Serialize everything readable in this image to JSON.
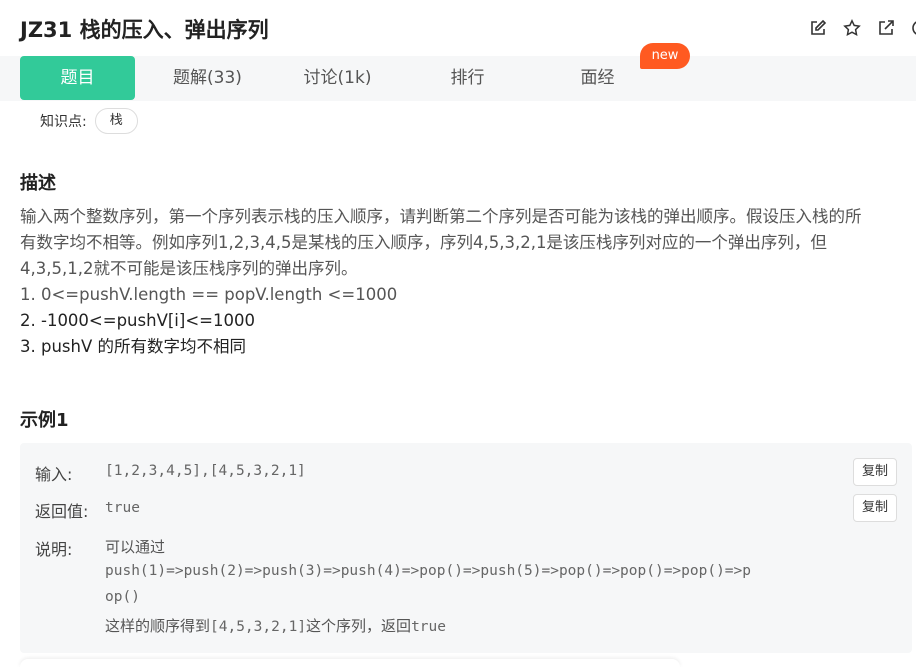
{
  "header": {
    "title": "JZ31  栈的压入、弹出序列",
    "icons": [
      "edit-icon",
      "star-icon",
      "share-icon",
      "more-icon"
    ]
  },
  "tabs": [
    {
      "label": "题目",
      "active": true
    },
    {
      "label": "题解(33)",
      "active": false
    },
    {
      "label": "讨论(1k)",
      "active": false
    },
    {
      "label": "排行",
      "active": false
    },
    {
      "label": "面经",
      "active": false
    }
  ],
  "new_badge": "new",
  "knowledge": {
    "label": "知识点:",
    "tag": "栈"
  },
  "description": {
    "heading": "描述",
    "lines": [
      "输入两个整数序列，第一个序列表示栈的压入顺序，请判断第二个序列是否可能为该栈的弹出顺序。假设压入栈的所",
      "有数字均不相等。例如序列1,2,3,4,5是某栈的压入顺序，序列4,5,3,2,1是该压栈序列对应的一个弹出序列，但",
      "4,3,5,1,2就不可能是该压栈序列的弹出序列。",
      "1. 0<=pushV.length == popV.length <=1000",
      "2. -1000<=pushV[i]<=1000",
      "3. pushV 的所有数字均不相同"
    ]
  },
  "example": {
    "heading": "示例1",
    "input_label": "输入:",
    "input_value": "[1,2,3,4,5],[4,5,3,2,1]",
    "output_label": "返回值:",
    "output_value": "true",
    "copy_label": "复制",
    "explain_label": "说明:",
    "explain_lines": [
      "可以通过",
      "push(1)=>push(2)=>push(3)=>push(4)=>pop()=>push(5)=>pop()=>pop()=>pop()=>p",
      "op()"
    ],
    "explain_last_prefix": "这样的顺序得到",
    "explain_last_seq": "[4,5,3,2,1]",
    "explain_last_mid": "这个序列，返回",
    "explain_last_true": "true"
  },
  "colors": {
    "accent": "#32ca99",
    "badge": "#ff5a21",
    "panel": "#f6f7f8"
  }
}
